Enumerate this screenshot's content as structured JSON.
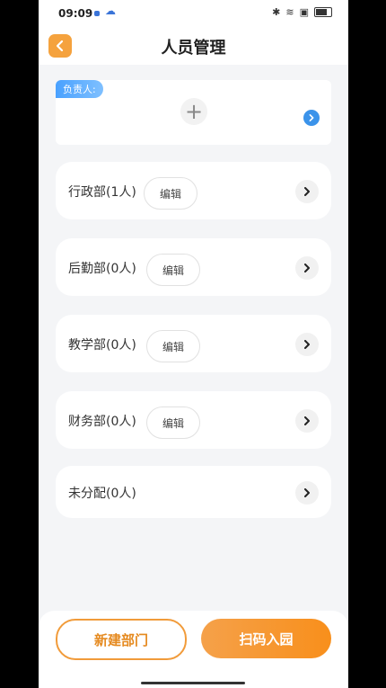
{
  "status_bar": {
    "time": "09:09"
  },
  "header": {
    "title": "人员管理"
  },
  "leader": {
    "tag": "负责人:",
    "add_symbol": "+"
  },
  "departments": [
    {
      "name": "行政部(1人)",
      "edit_label": "编辑"
    },
    {
      "name": "后勤部(0人)",
      "edit_label": "编辑"
    },
    {
      "name": "教学部(0人)",
      "edit_label": "编辑"
    },
    {
      "name": "财务部(0人)",
      "edit_label": "编辑"
    },
    {
      "name": "未分配(0人)"
    }
  ],
  "footer": {
    "new_department_label": "新建部门",
    "scan_join_label": "扫码入园"
  },
  "colors": {
    "accent": "#f5a23d",
    "blue": "#3b93ea",
    "background": "#f4f5f7"
  }
}
